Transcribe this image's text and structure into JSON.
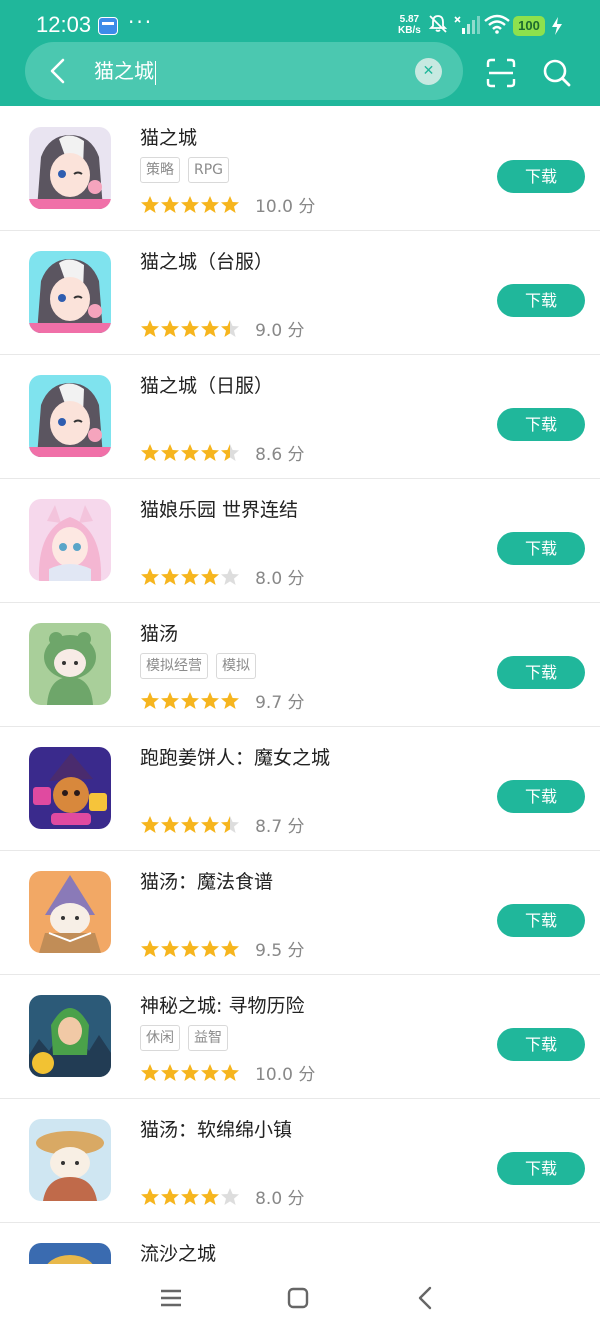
{
  "status": {
    "time": "12:03",
    "dots": "···",
    "speed_value": "5.87",
    "speed_unit": "KB/s",
    "battery": "100"
  },
  "search": {
    "query": "猫之城"
  },
  "actions": {
    "download_label": "下载"
  },
  "results": [
    {
      "title": "猫之城",
      "tags": [
        "策略",
        "RPG"
      ],
      "score": "10.0 分",
      "stars": 5,
      "icon": "app-icon-cat-city"
    },
    {
      "title": "猫之城（台服）",
      "tags": [],
      "score": "9.0 分",
      "stars": 4.5,
      "icon": "app-icon-cat-city-tw"
    },
    {
      "title": "猫之城（日服）",
      "tags": [],
      "score": "8.6 分",
      "stars": 4.5,
      "icon": "app-icon-cat-city-jp"
    },
    {
      "title": "猫娘乐园 世界连结",
      "tags": [],
      "score": "8.0 分",
      "stars": 4,
      "icon": "app-icon-catgirl-park"
    },
    {
      "title": "猫汤",
      "tags": [
        "模拟经营",
        "模拟"
      ],
      "score": "9.7 分",
      "stars": 5,
      "icon": "app-icon-cat-soup"
    },
    {
      "title": "跑跑姜饼人：魔女之城",
      "tags": [],
      "score": "8.7 分",
      "stars": 4.5,
      "icon": "app-icon-cookie-run"
    },
    {
      "title": "猫汤：魔法食谱",
      "tags": [],
      "score": "9.5 分",
      "stars": 5,
      "icon": "app-icon-cat-soup-magic"
    },
    {
      "title": "神秘之城: 寻物历险",
      "tags": [
        "休闲",
        "益智"
      ],
      "score": "10.0 分",
      "stars": 5,
      "icon": "app-icon-mystery-city"
    },
    {
      "title": "猫汤：软绵绵小镇",
      "tags": [],
      "score": "8.0 分",
      "stars": 4,
      "icon": "app-icon-cat-soup-town"
    },
    {
      "title": "流沙之城",
      "tags": [],
      "score": "",
      "stars": 0,
      "icon": "app-icon-quicksand-city"
    }
  ],
  "colors": {
    "accent": "#20b79b",
    "star": "#f6b51e",
    "star_empty": "#dddddd"
  }
}
